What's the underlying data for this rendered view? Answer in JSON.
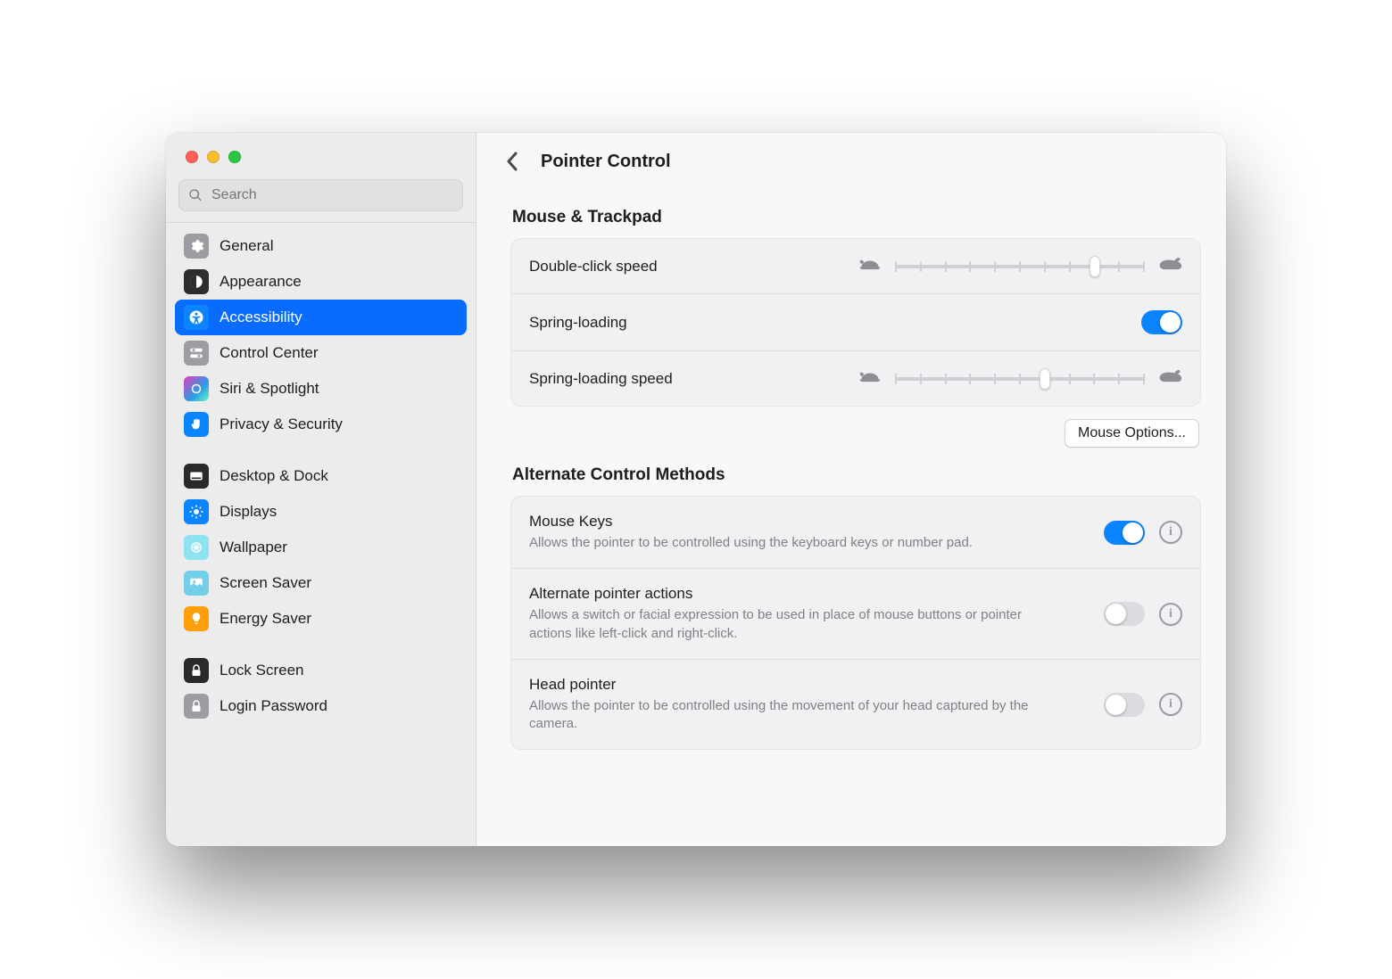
{
  "search": {
    "placeholder": "Search"
  },
  "sidebar": {
    "items": [
      {
        "id": "general",
        "label": "General"
      },
      {
        "id": "appearance",
        "label": "Appearance"
      },
      {
        "id": "accessibility",
        "label": "Accessibility"
      },
      {
        "id": "control-center",
        "label": "Control Center"
      },
      {
        "id": "siri-spotlight",
        "label": "Siri & Spotlight"
      },
      {
        "id": "privacy-security",
        "label": "Privacy & Security"
      },
      {
        "id": "desktop-dock",
        "label": "Desktop & Dock"
      },
      {
        "id": "displays",
        "label": "Displays"
      },
      {
        "id": "wallpaper",
        "label": "Wallpaper"
      },
      {
        "id": "screen-saver",
        "label": "Screen Saver"
      },
      {
        "id": "energy-saver",
        "label": "Energy Saver"
      },
      {
        "id": "lock-screen",
        "label": "Lock Screen"
      },
      {
        "id": "login-password",
        "label": "Login Password"
      }
    ]
  },
  "header": {
    "title": "Pointer Control"
  },
  "section_mouse_trackpad": {
    "title": "Mouse & Trackpad",
    "double_click_speed": {
      "label": "Double-click speed",
      "value": 8,
      "min": 0,
      "max": 10
    },
    "spring_loading": {
      "label": "Spring-loading",
      "enabled": true
    },
    "spring_loading_speed": {
      "label": "Spring-loading speed",
      "value": 6,
      "min": 0,
      "max": 10
    },
    "mouse_options_button": "Mouse Options..."
  },
  "section_alternate": {
    "title": "Alternate Control Methods",
    "rows": [
      {
        "title": "Mouse Keys",
        "desc": "Allows the pointer to be controlled using the keyboard keys or number pad.",
        "enabled": true
      },
      {
        "title": "Alternate pointer actions",
        "desc": "Allows a switch or facial expression to be used in place of mouse buttons or pointer actions like left-click and right-click.",
        "enabled": false
      },
      {
        "title": "Head pointer",
        "desc": "Allows the pointer to be controlled using the movement of your head captured by the camera.",
        "enabled": false
      }
    ]
  }
}
